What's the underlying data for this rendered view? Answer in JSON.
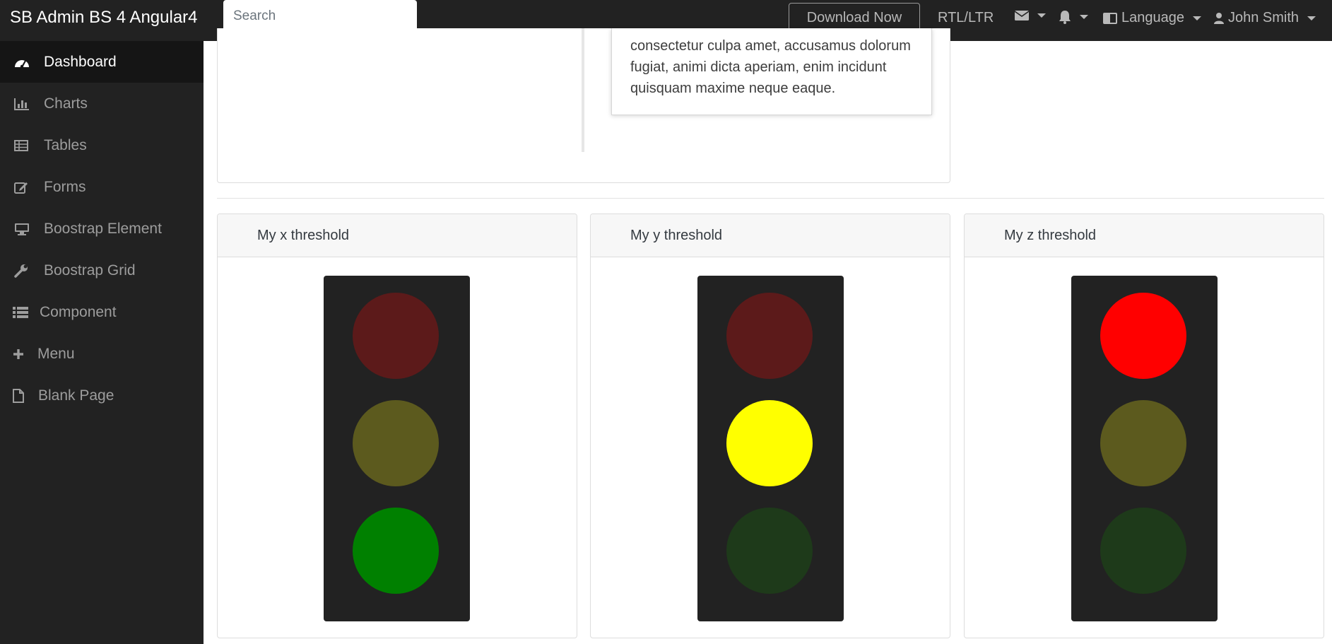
{
  "navbar": {
    "brand": "SB Admin BS 4 Angular4",
    "search_placeholder": "Search",
    "download_label": "Download Now",
    "rtl_label": "RTL/LTR",
    "language_label": "Language",
    "user_label": "John Smith",
    "icons": [
      "envelope-icon",
      "bell-icon",
      "language-icon",
      "user-icon"
    ]
  },
  "sidebar": {
    "items": [
      {
        "label": "Dashboard",
        "icon": "dashboard-icon",
        "active": true
      },
      {
        "label": "Charts",
        "icon": "bar-chart-icon"
      },
      {
        "label": "Tables",
        "icon": "table-icon"
      },
      {
        "label": "Forms",
        "icon": "edit-icon"
      },
      {
        "label": "Boostrap Element",
        "icon": "desktop-icon"
      },
      {
        "label": "Boostrap Grid",
        "icon": "wrench-icon"
      },
      {
        "label": "Component",
        "icon": "list-icon"
      },
      {
        "label": "Menu",
        "icon": "plus-icon"
      },
      {
        "label": "Blank Page",
        "icon": "file-icon"
      }
    ]
  },
  "timeline": {
    "text": "consectetur culpa amet, accusamus dolorum fugiat, animi dicta aperiam, enim incidunt quisquam maxime neque eaque."
  },
  "thresholds": [
    {
      "title": "My x threshold",
      "active": "green"
    },
    {
      "title": "My y threshold",
      "active": "yellow"
    },
    {
      "title": "My z threshold",
      "active": "red"
    }
  ],
  "colors": {
    "navbar_bg": "#222222",
    "red_on": "#ff0000",
    "red_off": "#5c1a1a",
    "yellow_on": "#ffff00",
    "yellow_off": "#5c5a1e",
    "green_on": "#008000",
    "green_off": "#1e3a1a"
  }
}
